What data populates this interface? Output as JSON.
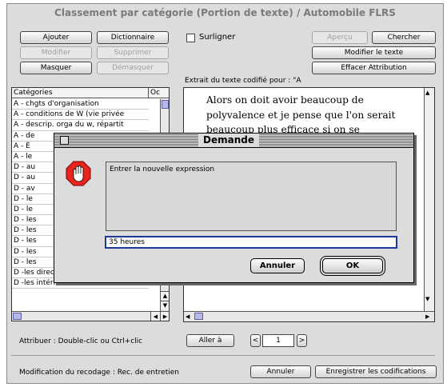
{
  "window": {
    "title": "Classement par catégorie (Portion de texte) / Automobile FLRS"
  },
  "toolbar": {
    "ajouter": "Ajouter",
    "dictionnaire": "Dictionnaire",
    "modifier": "Modifier",
    "supprimer": "Supprimer",
    "masquer": "Masquer",
    "demasquer": "Démasquer",
    "surligner": "Surligner",
    "apercu": "Aperçu",
    "chercher": "Chercher",
    "modifier_texte": "Modifier le texte",
    "effacer_attribution": "Effacer Attribution"
  },
  "extrait_label": "Extrait du texte codifié pour : \"A",
  "categories": {
    "header": "Catégories",
    "header2": "Oc",
    "rows": [
      "A - chgts d'organisation",
      "A - conditions de W (vie privée",
      "A - descrip. orga du w, répartit",
      "A - de",
      "A - É",
      "A - le",
      "D - au",
      "D - au",
      "D - av",
      "D - le",
      "D - le",
      "D - les",
      "D - les",
      "D - les",
      "D - les",
      "D - les",
      "D -les directs/les indirects",
      "D -les intérimaires"
    ]
  },
  "text_excerpt": "Alors on doit avoir beaucoup de polyvalence et je pense que l'on serait beaucoup plus efficace si on se",
  "bottom": {
    "attribuer": "Attribuer : Double-clic ou Ctrl+clic",
    "aller": "Aller à",
    "page": "1",
    "prev": "<",
    "next": ">",
    "modification": "Modification du recodage : Rec. de entretien",
    "annuler": "Annuler",
    "enregistrer": "Enregistrer les codifications"
  },
  "dialog": {
    "title": "Demande",
    "prompt": "Entrer la nouvelle expression",
    "value": "35 heures",
    "cancel": "Annuler",
    "ok": "OK",
    "icon": "stop-hand-icon",
    "icon_color": "#e8251c"
  }
}
